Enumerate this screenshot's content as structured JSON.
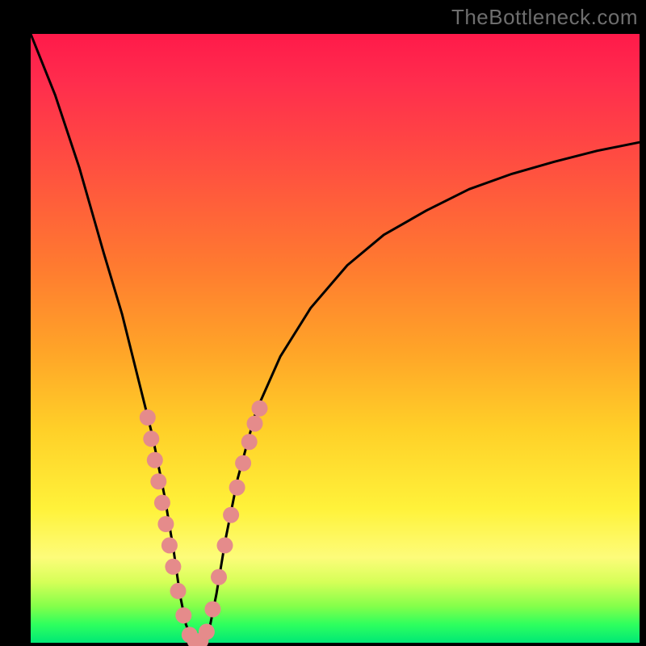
{
  "watermark": "TheBottleneck.com",
  "colors": {
    "frame": "#000000",
    "curve": "#000000",
    "marker": "#e58b8b",
    "gradient_top": "#ff1a4a",
    "gradient_mid": "#ffd028",
    "gradient_bottom": "#00e876"
  },
  "chart_data": {
    "type": "line",
    "title": "",
    "xlabel": "",
    "ylabel": "",
    "xlim": [
      0,
      100
    ],
    "ylim": [
      0,
      100
    ],
    "x": [
      0,
      4,
      8,
      12,
      15,
      18,
      20,
      22,
      23.5,
      24.5,
      25.5,
      26.5,
      27.5,
      28.5,
      29.5,
      30.5,
      32,
      34,
      37,
      41,
      46,
      52,
      58,
      65,
      72,
      79,
      86,
      93,
      100
    ],
    "y": [
      100,
      90,
      78,
      64,
      54,
      42,
      34,
      24,
      15,
      8,
      3,
      0.5,
      0.2,
      0.5,
      3,
      8,
      17,
      27,
      38,
      47,
      55,
      62,
      67,
      71,
      74.5,
      77,
      79,
      80.8,
      82.2
    ],
    "series": [
      {
        "name": "markers-left-branch",
        "x": [
          19.2,
          19.8,
          20.4,
          21.0,
          21.6,
          22.2,
          22.8,
          23.4,
          24.2,
          25.1,
          26.1,
          27.0,
          27.9,
          28.9,
          29.9
        ],
        "y": [
          37.0,
          33.5,
          30.0,
          26.5,
          23.0,
          19.5,
          16.0,
          12.5,
          8.5,
          4.5,
          1.3,
          0.3,
          0.3,
          1.8,
          5.5
        ]
      },
      {
        "name": "markers-right-branch",
        "x": [
          30.9,
          31.9,
          32.9,
          33.9,
          34.9,
          35.9,
          36.8,
          37.6
        ],
        "y": [
          10.8,
          16.0,
          21.0,
          25.5,
          29.5,
          33.0,
          36.0,
          38.5
        ]
      }
    ],
    "annotations": []
  }
}
